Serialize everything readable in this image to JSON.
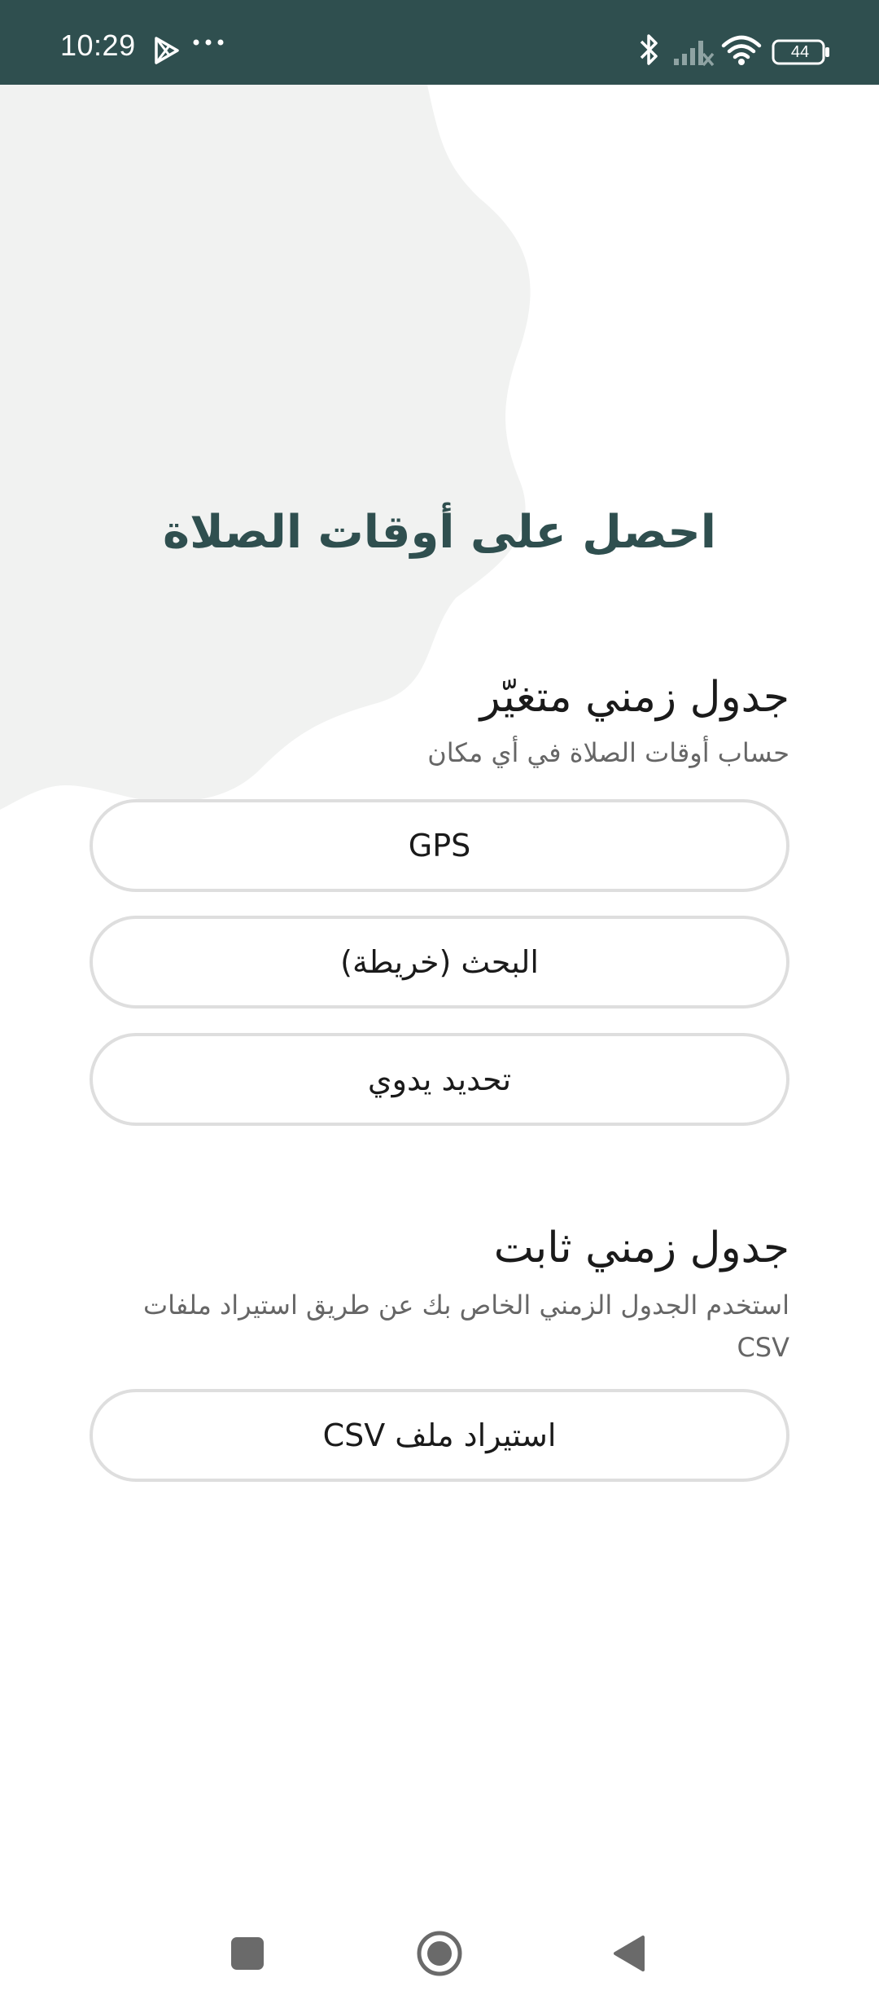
{
  "status_bar": {
    "time": "10:29",
    "battery": "44",
    "icons": [
      "play-store-notification-icon",
      "more-notifications-icon",
      "bluetooth-icon",
      "signal-icon",
      "wifi-icon",
      "battery-icon"
    ]
  },
  "hero": {
    "title": "احصل على أوقات الصلاة"
  },
  "dynamic": {
    "title": "جدول زمني متغيّر",
    "subtitle": "حساب أوقات الصلاة في أي مكان",
    "buttons": [
      "GPS",
      "البحث (خريطة)",
      "تحديد يدوي"
    ]
  },
  "fixed": {
    "title": "جدول زمني ثابت",
    "subtitle": "استخدم الجدول الزمني الخاص بك عن طريق استيراد ملفات CSV",
    "button": "استيراد ملف CSV"
  },
  "nav_bar": {
    "icons": [
      "recents-icon",
      "home-icon",
      "back-icon"
    ]
  },
  "colors": {
    "primary": "#2f4f4f",
    "blob": "#f1f2f1",
    "button_border": "#dedede"
  }
}
